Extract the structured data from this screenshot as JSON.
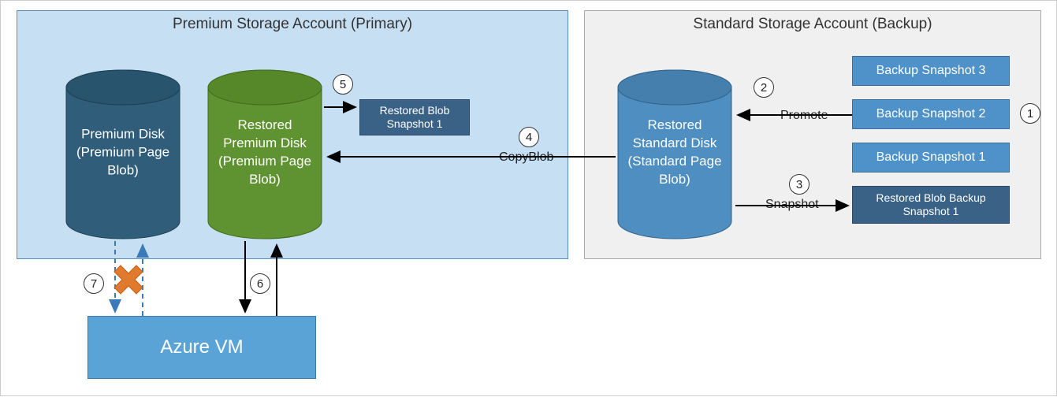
{
  "panels": {
    "primary_title": "Premium Storage Account (Primary)",
    "backup_title": "Standard Storage Account (Backup)"
  },
  "cylinders": {
    "premium_disk": "Premium Disk (Premium Page Blob)",
    "restored_premium_disk": "Restored Premium Disk (Premium Page Blob)",
    "restored_standard_disk": "Restored Standard Disk (Standard Page Blob)"
  },
  "boxes": {
    "restored_blob_snapshot1": "Restored Blob Snapshot 1",
    "backup_snapshot3": "Backup Snapshot 3",
    "backup_snapshot2": "Backup Snapshot 2",
    "backup_snapshot1": "Backup Snapshot 1",
    "restored_blob_backup_snapshot1": "Restored  Blob Backup Snapshot 1",
    "azure_vm": "Azure VM"
  },
  "labels": {
    "copyblob": "CopyBlob",
    "promote": "Promote",
    "snapshot": "Snapshot"
  },
  "steps": {
    "s1": "1",
    "s2": "2",
    "s3": "3",
    "s4": "4",
    "s5": "5",
    "s6": "6",
    "s7": "7"
  },
  "colors": {
    "primary_cyl_fill": "#2f5d7a",
    "primary_cyl_top": "#28546e",
    "restored_cyl_fill": "#5f9231",
    "restored_cyl_top": "#568829",
    "standard_cyl_fill": "#4f8ec0",
    "standard_cyl_top": "#457fad"
  }
}
